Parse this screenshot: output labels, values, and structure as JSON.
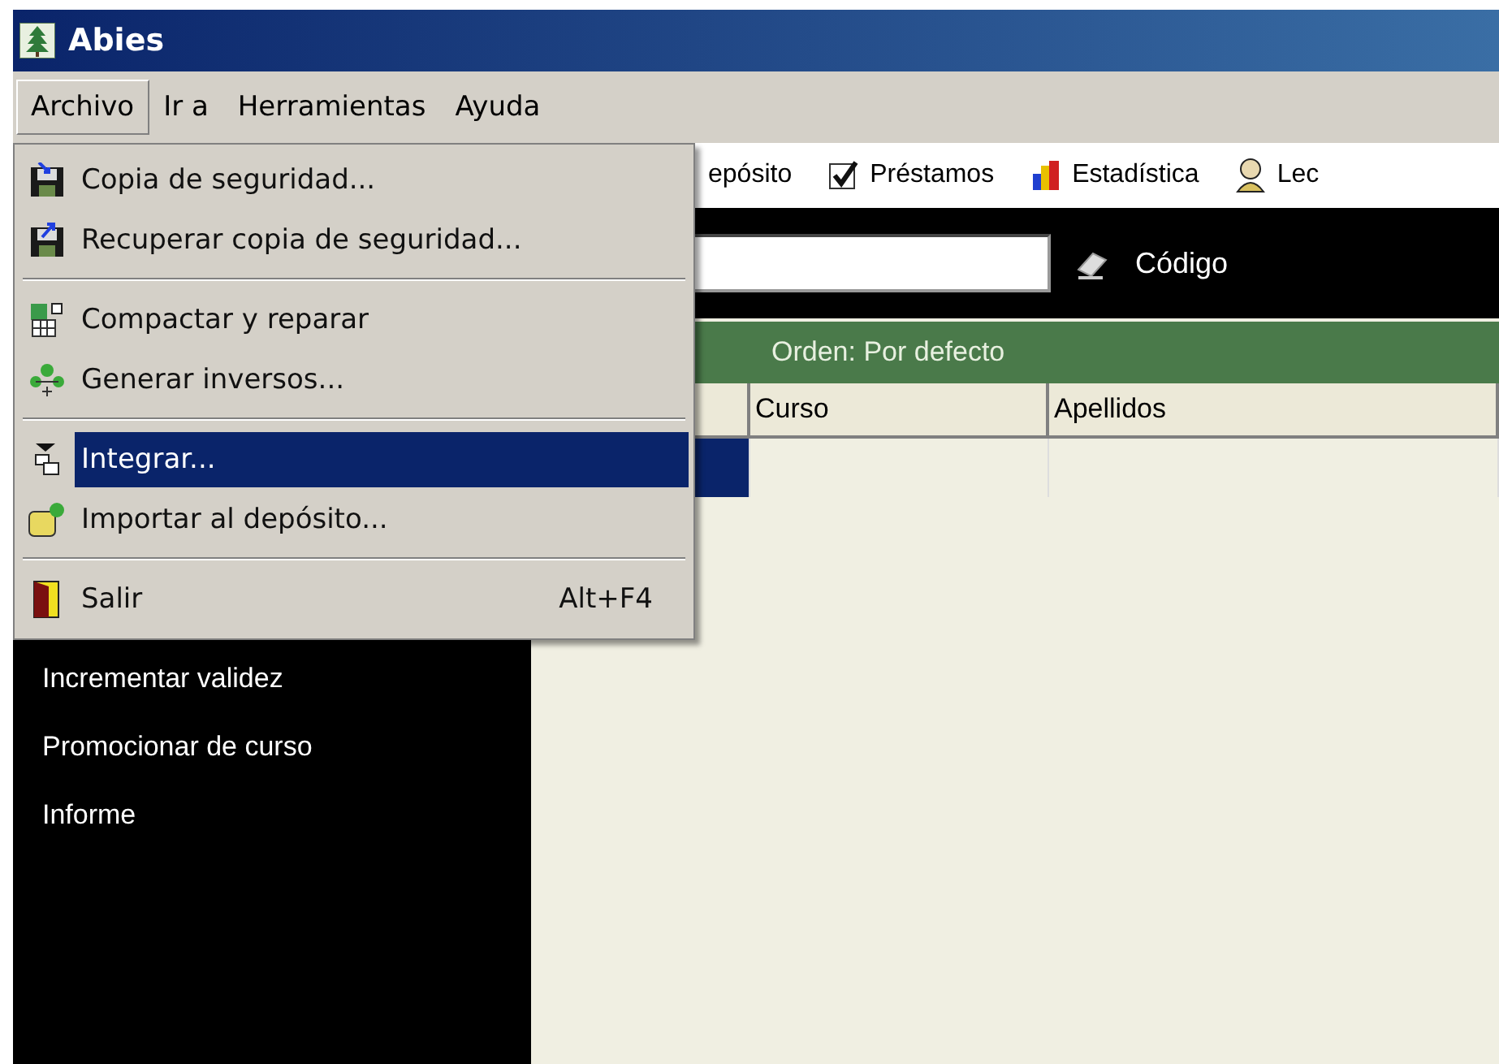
{
  "window": {
    "title": "Abies"
  },
  "menu_bar": [
    {
      "label": "Archivo",
      "selected": true
    },
    {
      "label": "Ir a",
      "selected": false
    },
    {
      "label": "Herramientas",
      "selected": false
    },
    {
      "label": "Ayuda",
      "selected": false
    }
  ],
  "file_menu": [
    {
      "kind": "item",
      "label": "Copia de seguridad...",
      "selected": false
    },
    {
      "kind": "item",
      "label": "Recuperar copia de seguridad...",
      "selected": false
    },
    {
      "kind": "separator"
    },
    {
      "kind": "item",
      "label": "Compactar y reparar",
      "selected": false
    },
    {
      "kind": "item",
      "label": "Generar inversos...",
      "selected": false
    },
    {
      "kind": "separator"
    },
    {
      "kind": "item",
      "label": "Integrar...",
      "selected": true
    },
    {
      "kind": "item",
      "label": "Importar al depósito...",
      "selected": false
    },
    {
      "kind": "separator"
    },
    {
      "kind": "item",
      "label": "Salir",
      "shortcut": "Alt+F4",
      "selected": false
    }
  ],
  "toolbar": [
    "epósito",
    "Préstamos",
    "Estadística",
    "Lec"
  ],
  "search": {
    "label": "Código"
  },
  "order_bar": "Orden: Por defecto",
  "sidebar": {
    "items": [
      "Incrementar validez",
      "Promocionar de curso",
      "Informe"
    ]
  },
  "table": {
    "columns": [
      "",
      "Curso",
      "Apellidos"
    ],
    "rows": [
      {
        "cells": [
          "",
          "",
          ""
        ],
        "selected": true
      }
    ]
  }
}
